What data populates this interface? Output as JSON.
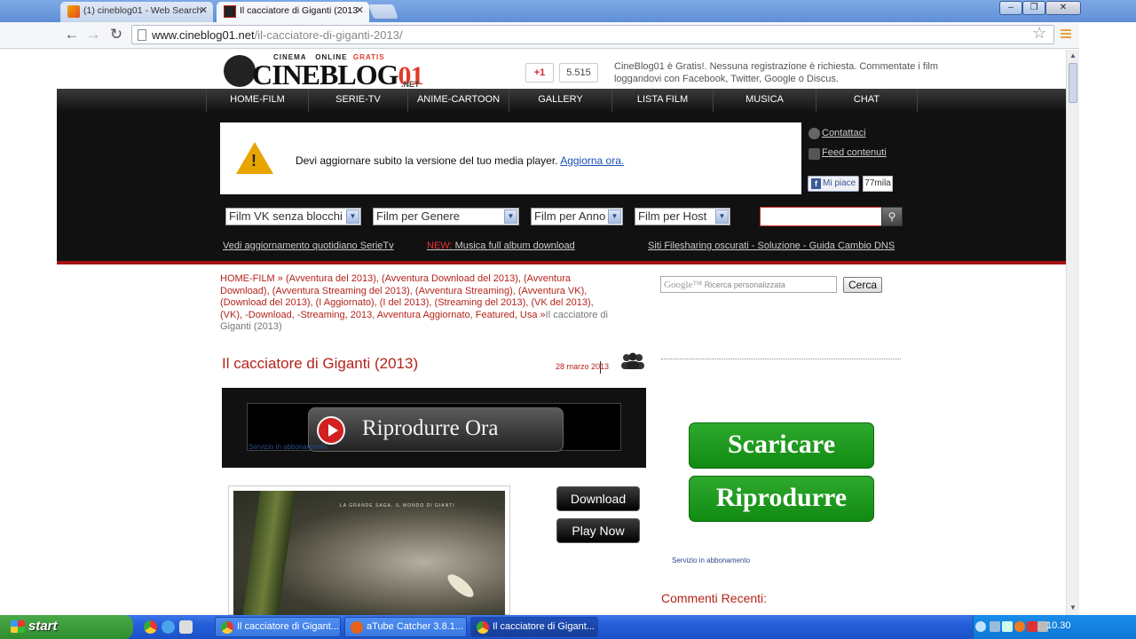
{
  "browser": {
    "tabs": [
      {
        "title": "(1) cineblog01 - Web Search",
        "active": false
      },
      {
        "title": "Il cacciatore di Giganti (2013",
        "active": true
      }
    ],
    "url_host": "www.cineblog01.net",
    "url_path": "/il-cacciatore-di-giganti-2013/",
    "window_buttons": [
      "–",
      "❐",
      "✕"
    ],
    "nav_icons": [
      "back-icon",
      "forward-icon",
      "reload-icon"
    ]
  },
  "site": {
    "logo": {
      "tag_cinema": "CINEMA",
      "tag_online": "ONLINE",
      "tag_gratis": "GRATIS",
      "brand": "CINEBLOG",
      "brand_num": "01",
      "net": ".NET"
    },
    "gplus_label": "+1",
    "gplus_count": "5.515",
    "header_text": "CineBlog01 è Gratis!. Nessuna registrazione è richiesta. Commentate i film loggandovi con Facebook, Twitter, Google o Discus.",
    "nav": [
      "HOME-FILM",
      "SERIE-TV",
      "ANIME-CARTOON",
      "GALLERY",
      "LISTA FILM",
      "MUSICA",
      "CHAT"
    ],
    "alert": {
      "message": "Devi aggiornare subito la versione del tuo media player.",
      "link": "Aggiorna ora."
    },
    "side_links": {
      "contact": "Contattaci",
      "feed": "Feed contenuti",
      "like": "Mi piace",
      "like_count": "77mila"
    },
    "selects": [
      "Film VK senza blocchi",
      "Film per Genere",
      "Film per Anno",
      "Film per Host"
    ],
    "band_links": {
      "serie": "Vedi aggiornamento quotidiano SerieTv",
      "new_tag": "NEW:",
      "musica": " Musica full album download",
      "filesharing": "Siti Filesharing oscurati - Soluzione - Guida Cambio DNS"
    }
  },
  "post": {
    "breadcrumb_links": "HOME-FILM » (Avventura del 2013), (Avventura Download del 2013), (Avventura Download), (Avventura Streaming del 2013), (Avventura Streaming), (Avventura VK), (Download del 2013), (I Aggiornato), (I del 2013), (Streaming del 2013), (VK del 2013), (VK), -Download, -Streaming, 2013, Avventura Aggiornato, Featured, Usa »",
    "breadcrumb_current": "Il cacciatore di Giganti (2013)",
    "title": "Il cacciatore di Giganti (2013)",
    "date": "28 marzo 2013",
    "player_label": "Riprodurre Ora",
    "servizio": "Servizio in abbonamento",
    "poster_tagline": "LA GRANDE SAGA. IL MONDO DI GIANTI",
    "download_btn": "Download",
    "play_btn": "Play Now"
  },
  "sidebar": {
    "google_label": "Google™",
    "search_placeholder": "Ricerca personalizzata",
    "cerca": "Cerca",
    "scaricare": "Scaricare",
    "riprodurre": "Riprodurre",
    "servizio": "Servizio in abbonamento",
    "commenti": "Commenti Recenti:"
  },
  "taskbar": {
    "start": "start",
    "items": [
      "Il cacciatore di Gigant...",
      "aTube Catcher 3.8.1...",
      "Il cacciatore di Gigant..."
    ],
    "clock": "10.30"
  },
  "colors": {
    "accent_red": "#b4231b",
    "nav_dark": "#111111",
    "green_btn": "#1f9a1f",
    "xp_blue": "#245edb"
  }
}
